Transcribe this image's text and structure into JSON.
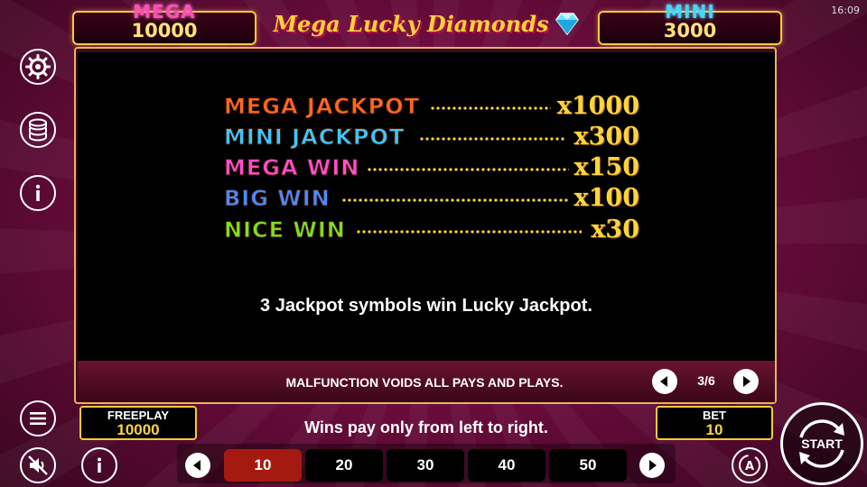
{
  "status": {
    "time": "16:09"
  },
  "game": {
    "title": "Mega Lucky Diamonds"
  },
  "jackpots": {
    "mega": {
      "label": "MEGA",
      "value": "10000"
    },
    "mini": {
      "label": "MINI",
      "value": "3000"
    }
  },
  "paytable": {
    "rows": [
      {
        "name": "MEGA JACKPOT",
        "multiplier": "x1000",
        "color": "#ff6a1e"
      },
      {
        "name": "MINI JACKPOT",
        "multiplier": "x300",
        "color": "#3cc8ff"
      },
      {
        "name": "MEGA WIN",
        "multiplier": "x150",
        "color": "#ff4fd0"
      },
      {
        "name": "BIG WIN",
        "multiplier": "x100",
        "color": "#4a8cff"
      },
      {
        "name": "NICE WIN",
        "multiplier": "x30",
        "color": "#7ee01e"
      }
    ],
    "rule": "3 Jackpot symbols win Lucky Jackpot.",
    "disclaimer": "MALFUNCTION VOIDS ALL PAYS AND PLAYS.",
    "page_indicator": "3/6"
  },
  "sidebar": {
    "icons": [
      "gear-icon",
      "coins-icon",
      "info-icon"
    ]
  },
  "footer": {
    "freeplay": {
      "label": "FREEPLAY",
      "value": "10000"
    },
    "bet": {
      "label": "BET",
      "value": "10"
    },
    "wins_note": "Wins pay only from left to right.",
    "bet_options": [
      "10",
      "20",
      "30",
      "40",
      "50"
    ],
    "selected_bet": "10",
    "start_label": "START",
    "auto_label": "A"
  },
  "colors": {
    "accent_gold": "#ffd43a",
    "selected_bet": "#a51a10"
  }
}
